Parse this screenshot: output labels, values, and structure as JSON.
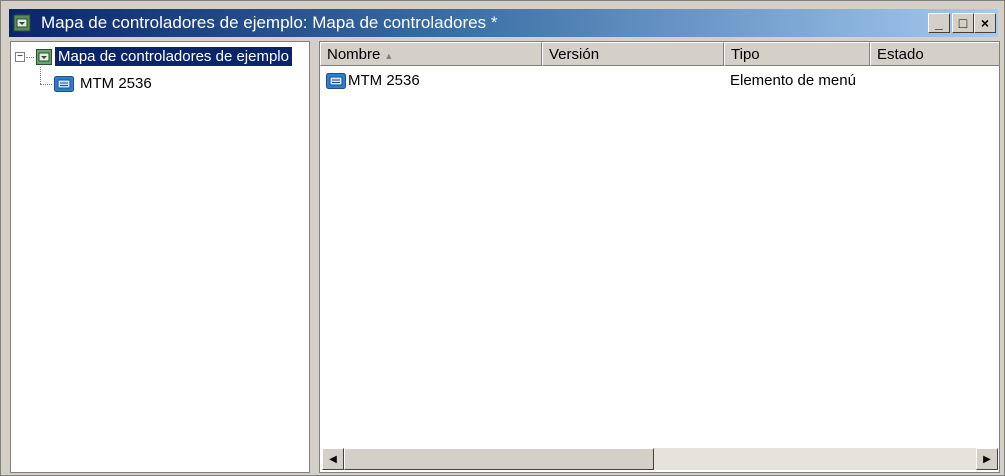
{
  "window": {
    "title": "Mapa de controladores de ejemplo: Mapa de controladores  *",
    "icon": "controller-map-icon",
    "buttons": {
      "minimize": "_",
      "maximize": "□",
      "close": "×"
    }
  },
  "tree": {
    "root": {
      "label": "Mapa de controladores de ejemplo",
      "icon": "controller-map-icon",
      "expander": "−"
    },
    "children": [
      {
        "label": "MTM 2536",
        "icon": "menu-item-icon"
      }
    ]
  },
  "list": {
    "columns": [
      "Nombre",
      "Versión",
      "Tipo",
      "Estado"
    ],
    "sort_indicator": "▲",
    "rows": [
      {
        "name": "MTM 2536",
        "version": "",
        "type": "Elemento de menú",
        "status": "",
        "icon": "menu-item-icon"
      }
    ]
  },
  "scrollbar": {
    "left_arrow": "◀",
    "right_arrow": "▶"
  },
  "colors": {
    "title_start": "#0a246a",
    "title_end": "#a6caf0",
    "selection": "#0a246a",
    "chrome": "#d4d0c8"
  }
}
